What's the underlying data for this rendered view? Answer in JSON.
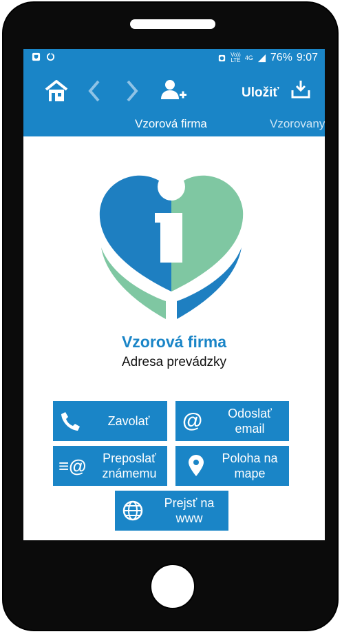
{
  "status_bar": {
    "network_top": "Vo))",
    "network_bottom": "LTE",
    "signal_label": "4G",
    "battery": "76%",
    "time": "9:07"
  },
  "toolbar": {
    "save_label": "Uložiť",
    "tabs": [
      {
        "label": "Vzorová firma"
      },
      {
        "label": "Vzorovany"
      }
    ]
  },
  "company": {
    "name": "Vzorová firma",
    "address": "Adresa prevádzky"
  },
  "actions": {
    "call": {
      "label": "Zavolať"
    },
    "email": {
      "line1": "Odoslať",
      "line2": "email"
    },
    "forward": {
      "line1": "Preposlať",
      "line2": "známemu"
    },
    "map": {
      "line1": "Poloha na",
      "line2": "mape"
    },
    "web": {
      "line1": "Prejsť na",
      "line2": "www"
    }
  },
  "colors": {
    "primary": "#1a85c7",
    "logo_blue": "#1e7fc1",
    "logo_green": "#7fc7a2"
  }
}
